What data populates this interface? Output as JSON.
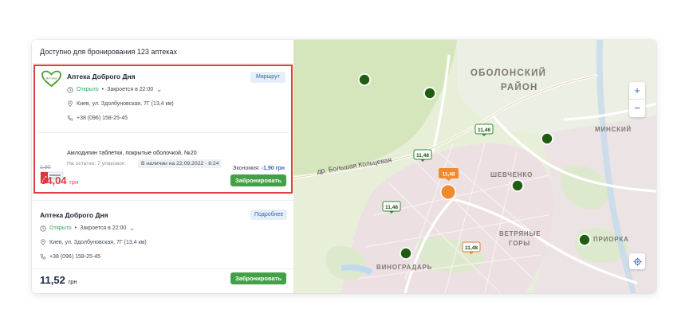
{
  "header": {
    "title": "Доступно для бронирования 123 аптеках"
  },
  "pharmacy_1": {
    "name": "Аптека Доброго Дня",
    "route_label": "Маршрут",
    "status": "Открыто",
    "hours": "Закроется в 22:00",
    "address": "Киев, ул. Здолбуновская, 7Г (13,4 км)",
    "phone": "+38 (096) 158-25-45",
    "product": "Амлодипин таблетки, покрытые оболочкой, №20",
    "stock": "На остатке: 7 упаковок",
    "availability": "В наличии на 22.09.2022 - 8:24",
    "old_price": "1,90",
    "economy_label": "Экономия:",
    "economy_value": "-1,90 грн",
    "price": "34,04",
    "currency": "грн",
    "book_label": "Забронировать"
  },
  "pharmacy_2": {
    "name": "Аптека Доброго Дня",
    "more_label": "Подробнее",
    "status": "Открыто",
    "hours": "Закроется в 22:00",
    "address": "Киев, ул. Здолбуновская, 7Г (13,4 км)",
    "phone": "+38 (096) 158-25-45",
    "price": "11,52",
    "currency": "грн",
    "book_label": "Забронировать"
  },
  "map": {
    "district_obolon_1": "ОБОЛОНСКИЙ",
    "district_obolon_2": "РАЙОН",
    "district_minsky": "МИНСКИЙ",
    "district_shevchenko": "ШЕВЧЕНКО",
    "district_vetryanye_1": "ВЕТРЯНЫЕ",
    "district_vetryanye_2": "ГОРЫ",
    "district_priorka": "ПРИОРКА",
    "district_vinogradar": "ВИНОГРАДАРЬ",
    "road": "др. Большая Кольцевая",
    "price_tags": [
      "11,48",
      "11,48",
      "11,48",
      "11,48",
      "11,48"
    ],
    "zoom_in": "+",
    "zoom_out": "−"
  },
  "colors": {
    "accent_green": "#43a047",
    "accent_red": "#e23c4a",
    "link_blue": "#3a68b5",
    "marker_green": "#1f5e12",
    "marker_orange": "#f08a2c",
    "selection_border": "#e03e3e"
  },
  "icons": {
    "clock": "clock-icon",
    "pin": "location-pin-icon",
    "phone": "phone-icon",
    "locate": "crosshair-icon"
  }
}
